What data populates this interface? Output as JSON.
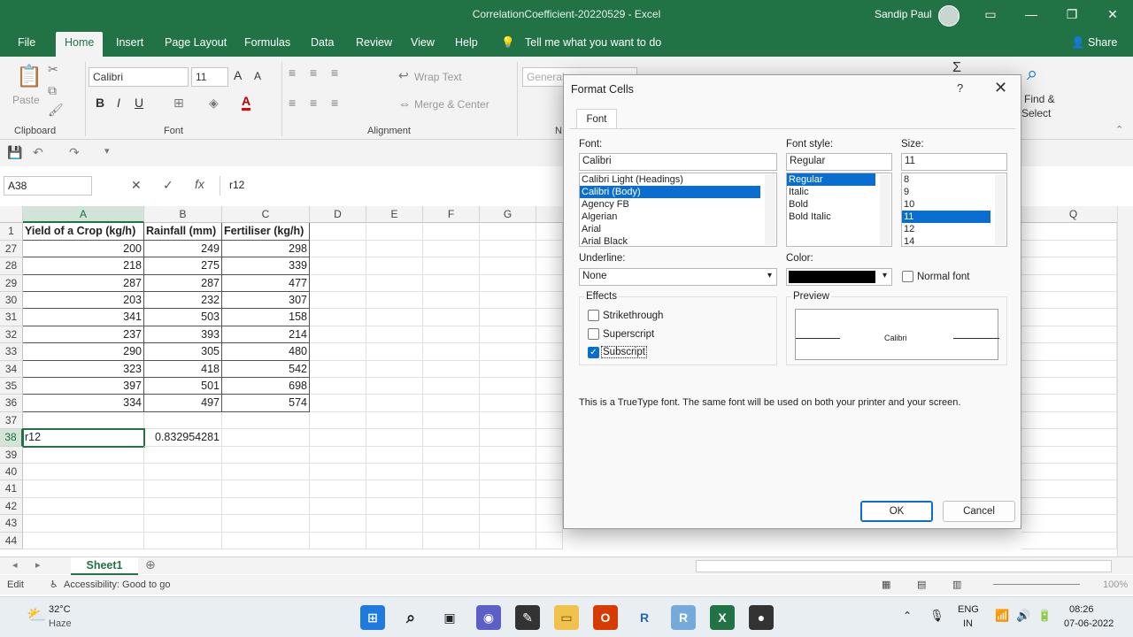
{
  "window": {
    "title": "CorrelationCoefficient-20220529  -  Excel",
    "user": "Sandip Paul"
  },
  "menu": {
    "tabs": [
      "File",
      "Home",
      "Insert",
      "Page Layout",
      "Formulas",
      "Data",
      "Review",
      "View",
      "Help"
    ],
    "tell_me": "Tell me what you want to do",
    "share": "Share"
  },
  "ribbon": {
    "paste": "Paste",
    "clipboard": "Clipboard",
    "font_name": "Calibri",
    "font_size": "11",
    "font_group": "Font",
    "alignment_group": "Alignment",
    "wrap_text": "Wrap Text",
    "merge_center": "Merge & Center",
    "number_format": "General",
    "number_group_trunc": "N",
    "find_select": "Find &",
    "find_select_2": "Select"
  },
  "formula_bar": {
    "name_box": "A38",
    "formula": "r12"
  },
  "grid": {
    "columns": [
      "A",
      "B",
      "C",
      "D",
      "E",
      "F",
      "G",
      "Q"
    ],
    "rows": [
      {
        "n": "1",
        "a": "Yield of a Crop (kg/h)",
        "b": "Rainfall (mm)",
        "c": "Fertiliser (kg/h)"
      },
      {
        "n": "27",
        "a": "200",
        "b": "249",
        "c": "298"
      },
      {
        "n": "28",
        "a": "218",
        "b": "275",
        "c": "339"
      },
      {
        "n": "29",
        "a": "287",
        "b": "287",
        "c": "477"
      },
      {
        "n": "30",
        "a": "203",
        "b": "232",
        "c": "307"
      },
      {
        "n": "31",
        "a": "341",
        "b": "503",
        "c": "158"
      },
      {
        "n": "32",
        "a": "237",
        "b": "393",
        "c": "214"
      },
      {
        "n": "33",
        "a": "290",
        "b": "305",
        "c": "480"
      },
      {
        "n": "34",
        "a": "323",
        "b": "418",
        "c": "542"
      },
      {
        "n": "35",
        "a": "397",
        "b": "501",
        "c": "698"
      },
      {
        "n": "36",
        "a": "334",
        "b": "497",
        "c": "574"
      },
      {
        "n": "37",
        "a": "",
        "b": "",
        "c": ""
      },
      {
        "n": "38",
        "a": "r12",
        "b": "0.832954281",
        "c": ""
      },
      {
        "n": "39",
        "a": "",
        "b": "",
        "c": ""
      },
      {
        "n": "40",
        "a": "",
        "b": "",
        "c": ""
      },
      {
        "n": "41",
        "a": "",
        "b": "",
        "c": ""
      },
      {
        "n": "42",
        "a": "",
        "b": "",
        "c": ""
      },
      {
        "n": "43",
        "a": "",
        "b": "",
        "c": ""
      },
      {
        "n": "44",
        "a": "",
        "b": "",
        "c": ""
      }
    ]
  },
  "sheet": {
    "tab": "Sheet1"
  },
  "status": {
    "mode": "Edit",
    "accessibility": "Accessibility: Good to go",
    "zoom": "100%"
  },
  "dialog": {
    "title": "Format Cells",
    "help": "?",
    "tab": "Font",
    "font_label": "Font:",
    "font_value": "Calibri",
    "fonts": [
      "Calibri Light (Headings)",
      "Calibri (Body)",
      "Agency FB",
      "Algerian",
      "Arial",
      "Arial Black"
    ],
    "font_selected": 1,
    "style_label": "Font style:",
    "style_value": "Regular",
    "styles": [
      "Regular",
      "Italic",
      "Bold",
      "Bold Italic"
    ],
    "style_selected": 0,
    "size_label": "Size:",
    "size_value": "11",
    "sizes": [
      "8",
      "9",
      "10",
      "11",
      "12",
      "14"
    ],
    "size_selected": 3,
    "underline_label": "Underline:",
    "underline_value": "None",
    "color_label": "Color:",
    "color_value": "#000000",
    "normal_font": "Normal font",
    "effects_label": "Effects",
    "strikethrough": "Strikethrough",
    "superscript": "Superscript",
    "subscript": "Subscript",
    "subscript_checked": true,
    "preview_label": "Preview",
    "preview_text": "Calibri",
    "info": "This is a TrueType font.  The same font will be used on both your printer and your screen.",
    "ok": "OK",
    "cancel": "Cancel"
  },
  "taskbar": {
    "weather_temp": "32°C",
    "weather_desc": "Haze",
    "lang_1": "ENG",
    "lang_2": "IN",
    "time": "08:26",
    "date": "07-06-2022"
  },
  "colors": {
    "excel_green": "#217346",
    "selection_blue": "#0a6ed1"
  }
}
